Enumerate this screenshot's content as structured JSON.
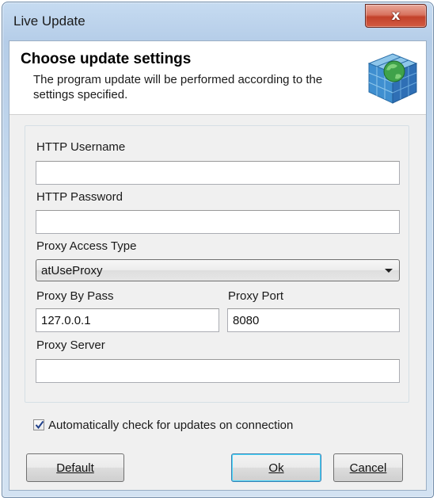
{
  "window": {
    "title": "Live Update",
    "close_glyph": "x"
  },
  "header": {
    "title": "Choose update settings",
    "description": "The program update will be performed according to the settings specified.",
    "icon": "cube-globe-icon"
  },
  "form": {
    "http_username": {
      "label": "HTTP Username",
      "value": ""
    },
    "http_password": {
      "label": "HTTP Password",
      "value": ""
    },
    "proxy_access_type": {
      "label": "Proxy Access Type",
      "value": "atUseProxy"
    },
    "proxy_bypass": {
      "label": "Proxy By Pass",
      "value": "127.0.0.1"
    },
    "proxy_port": {
      "label": "Proxy Port",
      "value": "8080"
    },
    "proxy_server": {
      "label": "Proxy Server",
      "value": ""
    }
  },
  "auto_check": {
    "label": "Automatically check for updates on connection",
    "checked": true
  },
  "buttons": {
    "default": "Default",
    "ok": "Ok",
    "cancel": "Cancel"
  }
}
